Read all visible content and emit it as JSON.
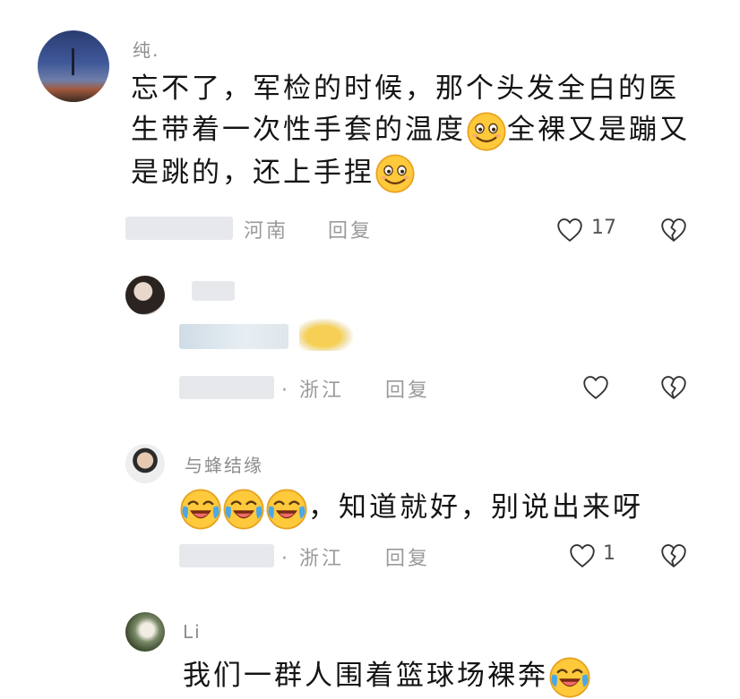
{
  "comments": [
    {
      "username": "纯.",
      "text_line1": "忘不了，军检的时候，那个头发全白的医",
      "text_line2": "生带着一次性手套的温度",
      "text_line2b": "全裸又是蹦又",
      "text_line3": "是跳的，还上手捏",
      "location": "河南",
      "reply_label": "回复",
      "like_count": "17"
    },
    {
      "username": "",
      "location": "· 浙江",
      "reply_label": "回复",
      "like_count": ""
    },
    {
      "username": "与蜂结缘",
      "text": "，知道就好，别说出来呀",
      "location": "· 浙江",
      "reply_label": "回复",
      "like_count": "1"
    },
    {
      "username": "Li",
      "text": "我们一群人围着篮球场裸奔"
    }
  ],
  "icons": {
    "like": "heart-outline-icon",
    "dislike": "broken-heart-icon",
    "smile": "smiling-face-emoji",
    "laugh_cry": "laughing-crying-emoji"
  },
  "colors": {
    "meta_gray": "#9a9a9a",
    "emoji_yellow": "#ffc93c",
    "tear_blue": "#4aa8e8"
  }
}
